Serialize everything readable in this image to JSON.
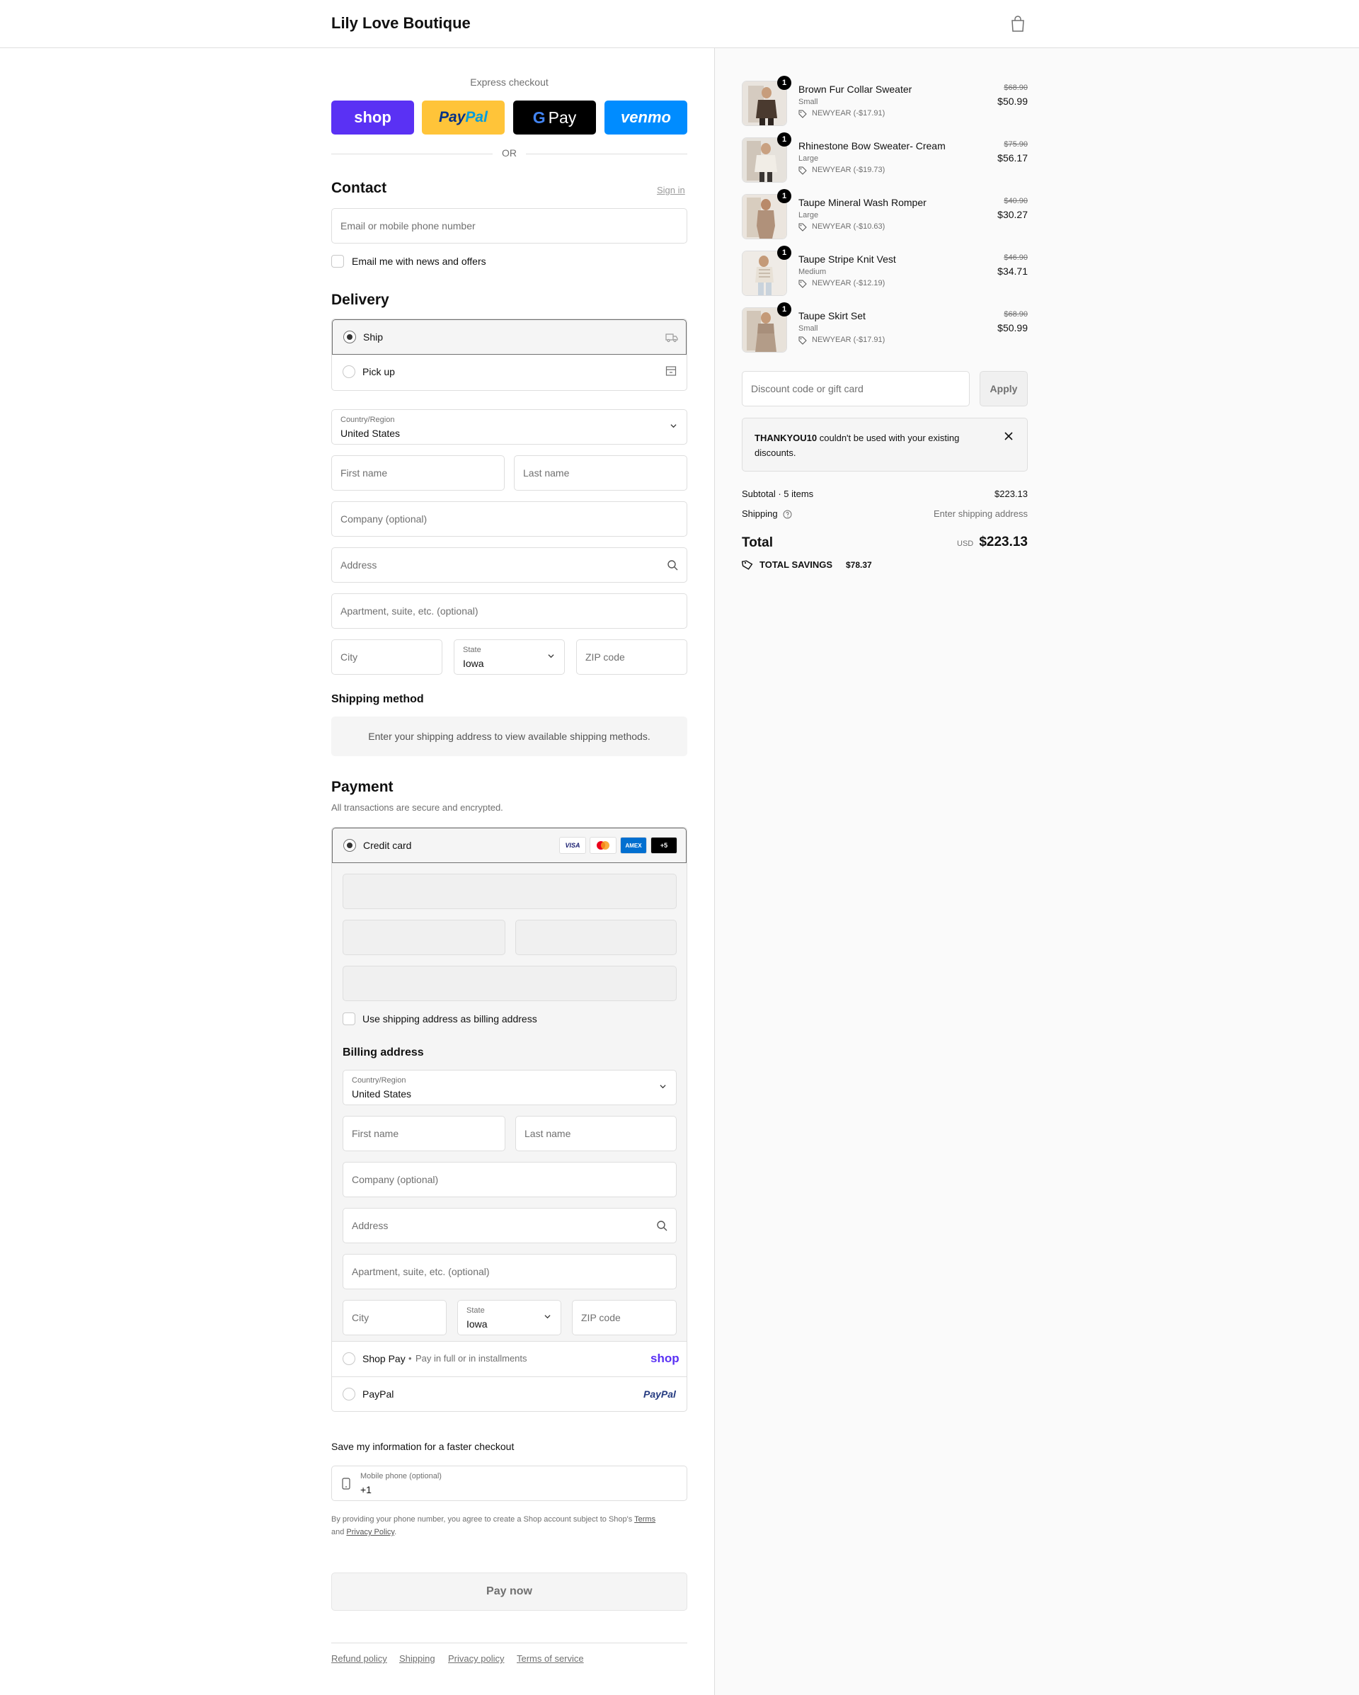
{
  "header": {
    "store_name": "Lily Love Boutique"
  },
  "express": {
    "label": "Express checkout",
    "buttons": [
      "shop",
      "PayPal",
      "G Pay",
      "venmo"
    ],
    "or": "OR"
  },
  "contact": {
    "title": "Contact",
    "sign_in": "Sign in",
    "email_placeholder": "Email or mobile phone number",
    "newsletter": "Email me with news and offers"
  },
  "delivery": {
    "title": "Delivery",
    "ship": "Ship",
    "pickup": "Pick up",
    "country_label": "Country/Region",
    "country": "United States",
    "first_name": "First name",
    "last_name": "Last name",
    "company": "Company (optional)",
    "address": "Address",
    "apartment": "Apartment, suite, etc. (optional)",
    "city": "City",
    "state_label": "State",
    "state": "Iowa",
    "zip": "ZIP code"
  },
  "shipping_method": {
    "title": "Shipping method",
    "message": "Enter your shipping address to view available shipping methods."
  },
  "payment": {
    "title": "Payment",
    "subtitle": "All transactions are secure and encrypted.",
    "credit_card": "Credit card",
    "card_logos": [
      "VISA",
      "mastercard",
      "AMEX",
      "+5"
    ],
    "use_shipping": "Use shipping address as billing address",
    "billing_title": "Billing address",
    "country_label": "Country/Region",
    "country": "United States",
    "first_name": "First name",
    "last_name": "Last name",
    "company": "Company (optional)",
    "address": "Address",
    "apartment": "Apartment, suite, etc. (optional)",
    "city": "City",
    "state_label": "State",
    "state": "Iowa",
    "zip": "ZIP code",
    "shop_pay": "Shop Pay",
    "shop_pay_note": "Pay in full or in installments",
    "shop_pay_logo": "shop",
    "paypal": "PayPal",
    "paypal_logo": "PayPal"
  },
  "save_info": {
    "title": "Save my information for a faster checkout",
    "phone_label": "Mobile phone (optional)",
    "phone_value": "+1",
    "legal_1": "By providing your phone number, you agree to create a Shop account subject to Shop's",
    "terms": "Terms",
    "legal_and": "and",
    "privacy": "Privacy Policy",
    "legal_end": "."
  },
  "pay_now": "Pay now",
  "footer_links": [
    "Refund policy",
    "Shipping",
    "Privacy policy",
    "Terms of service"
  ],
  "order": {
    "items": [
      {
        "name": "Brown Fur Collar Sweater",
        "variant": "Small",
        "discount": "NEWYEAR (-$17.91)",
        "old_price": "$68.90",
        "price": "$50.99",
        "qty": "1"
      },
      {
        "name": "Rhinestone Bow Sweater- Cream",
        "variant": "Large",
        "discount": "NEWYEAR (-$19.73)",
        "old_price": "$75.90",
        "price": "$56.17",
        "qty": "1"
      },
      {
        "name": "Taupe Mineral Wash Romper",
        "variant": "Large",
        "discount": "NEWYEAR (-$10.63)",
        "old_price": "$40.90",
        "price": "$30.27",
        "qty": "1"
      },
      {
        "name": "Taupe Stripe Knit Vest",
        "variant": "Medium",
        "discount": "NEWYEAR (-$12.19)",
        "old_price": "$46.90",
        "price": "$34.71",
        "qty": "1"
      },
      {
        "name": "Taupe Skirt Set",
        "variant": "Small",
        "discount": "NEWYEAR (-$17.91)",
        "old_price": "$68.90",
        "price": "$50.99",
        "qty": "1"
      }
    ],
    "discount_placeholder": "Discount code or gift card",
    "apply": "Apply",
    "notice_code": "THANKYOU10",
    "notice_text": " couldn't be used with your existing",
    "notice_text_2": "discounts.",
    "subtotal_label": "Subtotal · 5 items",
    "subtotal": "$223.13",
    "shipping_label": "Shipping",
    "shipping_value": "Enter shipping address",
    "total_label": "Total",
    "currency": "USD",
    "total": "$223.13",
    "savings_label": "TOTAL SAVINGS",
    "savings": "$78.37"
  },
  "colors": {
    "shop_purple": "#5a31f4",
    "paypal_yellow": "#ffc439",
    "venmo_blue": "#008cff",
    "border": "#dedede",
    "muted_text": "#707070"
  }
}
